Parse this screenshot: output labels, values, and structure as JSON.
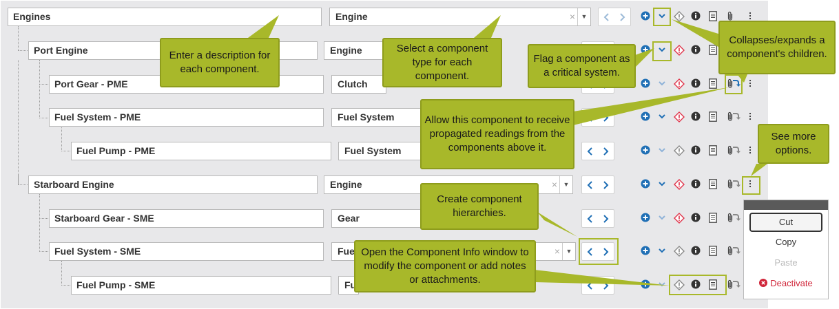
{
  "rows": [
    {
      "name": "Engines",
      "type": "Engine"
    },
    {
      "name": "Port Engine",
      "type": "Engine"
    },
    {
      "name": "Port Gear - PME",
      "type": "Clutch"
    },
    {
      "name": "Fuel System - PME",
      "type": "Fuel System"
    },
    {
      "name": "Fuel Pump - PME",
      "type": "Fuel System"
    },
    {
      "name": "Starboard Engine",
      "type": "Engine"
    },
    {
      "name": "Starboard Gear - SME",
      "type": "Gear"
    },
    {
      "name": "Fuel System - SME",
      "type": "Fue"
    },
    {
      "name": "Fuel Pump - SME",
      "type": "Fu"
    }
  ],
  "clear_glyph": "×",
  "callouts": {
    "description": "Enter a description for each component.",
    "type": "Select a component type for each component.",
    "critical": "Flag a component as a critical system.",
    "collapse": "Collapses/expands a component's children.",
    "propagate": "Allow this component to receive propagated readings from the components above it.",
    "more": "See more options.",
    "hierarchy": "Create component hierarchies.",
    "info": "Open the Component Info window to modify the component or add notes or attachments."
  },
  "menu": {
    "cut": "Cut",
    "copy": "Copy",
    "paste": "Paste",
    "deactivate": "Deactivate"
  },
  "colors": {
    "callout": "#a8b82a",
    "accent_blue": "#1f6fb5",
    "critical_red": "#e0334a",
    "panel": "#e8e8ea"
  },
  "icons": [
    "arrow-left-icon",
    "arrow-right-icon",
    "add-icon",
    "chevron-down-icon",
    "critical-diamond-icon",
    "info-icon",
    "notes-icon",
    "attachment-icon",
    "propagate-arrow-icon",
    "more-icon"
  ]
}
